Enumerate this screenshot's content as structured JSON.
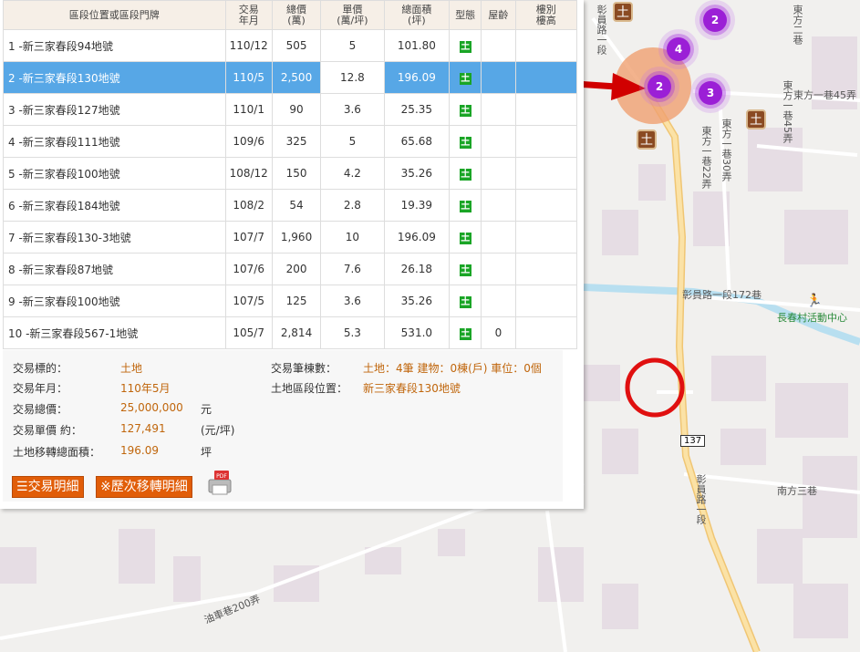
{
  "table": {
    "headers": [
      "區段位置或區段門牌",
      "交易\n年月",
      "總價\n(萬)",
      "單價\n(萬/坪)",
      "總面積\n(坪)",
      "型態",
      "屋齡",
      "樓別\n樓高"
    ],
    "rows": [
      {
        "loc": "1 -新三家春段94地號",
        "date": "110/12",
        "total": "505",
        "unit": "5",
        "area": "101.80",
        "type": "土",
        "age": ""
      },
      {
        "loc": "2 -新三家春段130地號",
        "date": "110/5",
        "total": "2,500",
        "unit": "12.8",
        "area": "196.09",
        "type": "土",
        "age": ""
      },
      {
        "loc": "3 -新三家春段127地號",
        "date": "110/1",
        "total": "90",
        "unit": "3.6",
        "area": "25.35",
        "type": "土",
        "age": ""
      },
      {
        "loc": "4 -新三家春段111地號",
        "date": "109/6",
        "total": "325",
        "unit": "5",
        "area": "65.68",
        "type": "土",
        "age": ""
      },
      {
        "loc": "5 -新三家春段100地號",
        "date": "108/12",
        "total": "150",
        "unit": "4.2",
        "area": "35.26",
        "type": "土",
        "age": ""
      },
      {
        "loc": "6 -新三家春段184地號",
        "date": "108/2",
        "total": "54",
        "unit": "2.8",
        "area": "19.39",
        "type": "土",
        "age": ""
      },
      {
        "loc": "7 -新三家春段130-3地號",
        "date": "107/7",
        "total": "1,960",
        "unit": "10",
        "area": "196.09",
        "type": "土",
        "age": ""
      },
      {
        "loc": "8 -新三家春段87地號",
        "date": "107/6",
        "total": "200",
        "unit": "7.6",
        "area": "26.18",
        "type": "土",
        "age": ""
      },
      {
        "loc": "9 -新三家春段100地號",
        "date": "107/5",
        "total": "125",
        "unit": "3.6",
        "area": "35.26",
        "type": "土",
        "age": ""
      },
      {
        "loc": "10 -新三家春段567-1地號",
        "date": "105/7",
        "total": "2,814",
        "unit": "5.3",
        "area": "531.0",
        "type": "土",
        "age": "0"
      }
    ]
  },
  "detail": {
    "target_label": "交易標的：",
    "target_value": "土地",
    "ym_label": "交易年月：",
    "ym_value": "110年5月",
    "total_label": "交易總價：",
    "total_value": "25,000,000",
    "total_unit": "元",
    "unit_label": "交易單價 約：",
    "unit_value": "127,491",
    "unit_unit": "(元/坪)",
    "area_label": "土地移轉總面積：",
    "area_value": "196.09",
    "area_unit": "坪",
    "count_label": "交易筆棟數：",
    "count_value": "土地：4筆 建物：0棟(戶) 車位：0個",
    "section_label": "土地區段位置：",
    "section_value": "新三家春段130地號"
  },
  "buttons": {
    "detail": "交易明細",
    "history": "※歷次移轉明細",
    "pdf": "PDF"
  },
  "map": {
    "labels": {
      "road_main": "彰員路一段",
      "road_main_s": "彰員路一段",
      "lane_172": "彰員路一段172巷",
      "center": "長春村活動中心",
      "east1": "東方一巷45弄",
      "east2": "東方一巷30弄",
      "east3": "東方一巷22弄",
      "south3": "南方三巷",
      "oil": "油車巷200弄",
      "top_right": "東方二巷",
      "shield": "137"
    },
    "clusters": [
      "2",
      "4",
      "2",
      "3"
    ]
  },
  "colors": {
    "selected_row": "#57a7e6",
    "accent": "#e15d08",
    "value_text": "#c0660c"
  }
}
